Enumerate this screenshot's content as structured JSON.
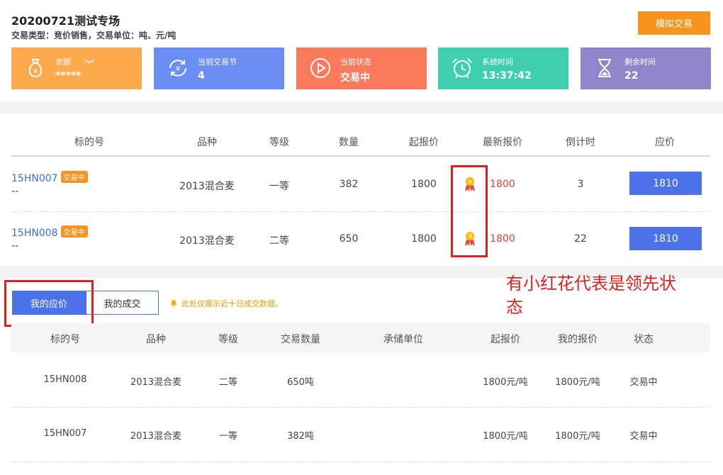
{
  "header": {
    "title": "20200721测试专场",
    "subtitle": "交易类型：竞价销售，交易单位：吨、元/吨",
    "sim_button": "模拟交易"
  },
  "cards": [
    {
      "label": "余额",
      "value": "*****",
      "icon": "money-bag-icon",
      "color": "#ffa94d"
    },
    {
      "label": "当前交易节",
      "value": "4",
      "icon": "yen-refresh-icon",
      "color": "#6b8ef5"
    },
    {
      "label": "当前状态",
      "value": "交易中",
      "icon": "play-icon",
      "color": "#fa7b5b"
    },
    {
      "label": "系统时间",
      "value": "13:37:42",
      "icon": "alarm-clock-icon",
      "color": "#3fcfb0"
    },
    {
      "label": "剩余时间",
      "value": "22",
      "icon": "hourglass-icon",
      "color": "#8e85cb"
    }
  ],
  "lots": {
    "headers": [
      "标的号",
      "品种",
      "等级",
      "数量",
      "起报价",
      "最新报价",
      "倒计时",
      "应价"
    ],
    "rows": [
      {
        "code": "15HN007",
        "badge": "交易中",
        "sub": "--",
        "variety": "2013混合麦",
        "grade": "一等",
        "qty": "382",
        "start": "1800",
        "latest": "1800",
        "countdown": "3",
        "bid": "1810"
      },
      {
        "code": "15HN008",
        "badge": "交易中",
        "sub": "--",
        "variety": "2013混合麦",
        "grade": "二等",
        "qty": "650",
        "start": "1800",
        "latest": "1800",
        "countdown": "22",
        "bid": "1810"
      }
    ]
  },
  "records": {
    "tab_bids": "我的应价",
    "tab_deals": "我的成交",
    "notice": "此处仅展示近十日成交数据。",
    "headers": [
      "标的号",
      "品种",
      "等级",
      "交易数量",
      "承储单位",
      "起报价",
      "我的报价",
      "状态"
    ],
    "rows": [
      {
        "code": "15HN008",
        "variety": "2013混合麦",
        "grade": "二等",
        "qty": "650吨",
        "unit": "",
        "start": "1800元/吨",
        "mine": "1800元/吨",
        "status": "交易中"
      },
      {
        "code": "15HN007",
        "variety": "2013混合麦",
        "grade": "一等",
        "qty": "382吨",
        "unit": "",
        "start": "1800元/吨",
        "mine": "1800元/吨",
        "status": "交易中"
      }
    ]
  },
  "annotation": "有小红花代表是领先状态"
}
